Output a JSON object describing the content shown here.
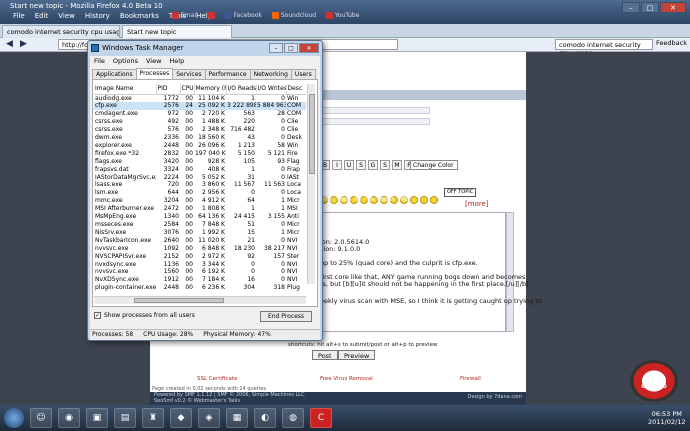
{
  "browser": {
    "title": "Start new topic - Mozilla Firefox 4.0 Beta 10",
    "menu": [
      "File",
      "Edit",
      "View",
      "History",
      "Bookmarks",
      "Tools",
      "Help"
    ],
    "bookmarks": [
      "",
      "Email",
      "",
      "Facebook",
      "Soundcloud",
      "YouTube"
    ],
    "tabs": [
      "comodo internet security cpu usage ...",
      "Start new topic"
    ],
    "url": "http://for",
    "search": "comodo internet security cpu usage",
    "feedback": "Feedback"
  },
  "forum": {
    "color_select": "Change Color",
    "off_topic": "OFF TOPIC",
    "more": "[more]",
    "lines": [
      "ion: 2.0.5614.0",
      "sion: 9.1.0.0",
      "up to 25% (quad core) and the culprit is cfp.exe.",
      "first core like that, ANY game running bogs down and becomes",
      "ts, but [b][u]it should not be happening in the first place.[/u][/b]",
      "eekly virus scan with MSE, so I think it is getting caught up trying to"
    ],
    "hint": "shortcuts: hit alt+s to submit/post or alt+p to preview",
    "post_button": "Post",
    "preview_button": "Preview",
    "footer_links": [
      "SSL Certificate",
      "Free Virus Removal",
      "Firewall"
    ],
    "page_created": "Page created in 0.02 seconds with 14 queries.",
    "footer_lines": [
      "Powered by SMF 1.1.12 | SMF © 2006, Simple Machines LLC",
      "SeoSmf v0.2 © Webmaster's Talks"
    ],
    "design_by": "Design by 7dana.com",
    "comodo_badge": "COMODO"
  },
  "taskmanager": {
    "title": "Windows Task Manager",
    "menu": [
      "File",
      "Options",
      "View",
      "Help"
    ],
    "tabs": [
      "Applications",
      "Processes",
      "Services",
      "Performance",
      "Networking",
      "Users"
    ],
    "columns": [
      "Image Name",
      "PID",
      "CPU",
      "Memory (Pr...",
      "I/O Reads",
      "I/O Writes",
      "Desc"
    ],
    "rows": [
      [
        "audiodg.exe",
        "1772",
        "00",
        "11 104 K",
        "1",
        "0",
        "Win"
      ],
      [
        "cfp.exe",
        "2576",
        "24",
        "25 092 K",
        "3 222 898",
        "5 884 963",
        "COM"
      ],
      [
        "cmdagent.exe",
        "972",
        "00",
        "2 720 K",
        "563",
        "28",
        "COM"
      ],
      [
        "csrss.exe",
        "492",
        "00",
        "1 488 K",
        "220",
        "0",
        "Clie"
      ],
      [
        "csrss.exe",
        "576",
        "00",
        "2 348 K",
        "716 482",
        "0",
        "Clie"
      ],
      [
        "dwm.exe",
        "2336",
        "00",
        "18 560 K",
        "43",
        "0",
        "Desk"
      ],
      [
        "explorer.exe",
        "2448",
        "00",
        "26 096 K",
        "1 213",
        "58",
        "Win"
      ],
      [
        "firefox.exe *32",
        "2832",
        "00",
        "197 040 K",
        "5 150",
        "5 121",
        "Fire"
      ],
      [
        "flags.exe",
        "3420",
        "00",
        "928 K",
        "105",
        "93",
        "Flag"
      ],
      [
        "frapsvs.dat",
        "3324",
        "00",
        "408 K",
        "1",
        "0",
        "Frap"
      ],
      [
        "IAStorDataMgrSvc.exe",
        "2224",
        "00",
        "5 052 K",
        "31",
        "0",
        "IASt"
      ],
      [
        "lsass.exe",
        "720",
        "00",
        "3 860 K",
        "11 567",
        "11 563",
        "Loca"
      ],
      [
        "lsm.exe",
        "644",
        "00",
        "2 956 K",
        "0",
        "0",
        "Loca"
      ],
      [
        "mmc.exe",
        "3204",
        "00",
        "4 912 K",
        "64",
        "1",
        "Micr"
      ],
      [
        "MSI Afterburner.exe",
        "2472",
        "00",
        "1 808 K",
        "1",
        "1",
        "MSI"
      ],
      [
        "MsMpEng.exe",
        "1340",
        "00",
        "64 136 K",
        "24 415",
        "3 155",
        "Anti"
      ],
      [
        "msseces.exe",
        "2584",
        "00",
        "7 848 K",
        "51",
        "0",
        "Micr"
      ],
      [
        "NisSrv.exe",
        "3076",
        "00",
        "1 992 K",
        "15",
        "1",
        "Micr"
      ],
      [
        "NvTaskbarIcon.exe",
        "2640",
        "00",
        "11 020 K",
        "21",
        "0",
        "NVI"
      ],
      [
        "nvvsvc.exe",
        "1092",
        "00",
        "6 848 K",
        "18 230",
        "38 217",
        "NVI"
      ],
      [
        "NVSCPAPISvr.exe",
        "2152",
        "00",
        "2 972 K",
        "92",
        "157",
        "Ster"
      ],
      [
        "nvxdsync.exe",
        "1136",
        "00",
        "3 344 K",
        "0",
        "0",
        "NVI"
      ],
      [
        "nvvsvc.exe",
        "1560",
        "00",
        "6 192 K",
        "0",
        "0",
        "NVI"
      ],
      [
        "NvXDSync.exe",
        "1912",
        "00",
        "7 184 K",
        "16",
        "0",
        "NVI"
      ],
      [
        "plugin-container.exe",
        "2448",
        "00",
        "6 236 K",
        "304",
        "318",
        "Plug"
      ]
    ],
    "show_all_label": "Show processes from all users",
    "end_process": "End Process",
    "status": [
      "Processes: 58",
      "CPU Usage: 28%",
      "Physical Memory: 47%"
    ]
  },
  "watermark": "photobucket",
  "clock": {
    "time": "06:53 PM",
    "date": "2011/02/12"
  }
}
